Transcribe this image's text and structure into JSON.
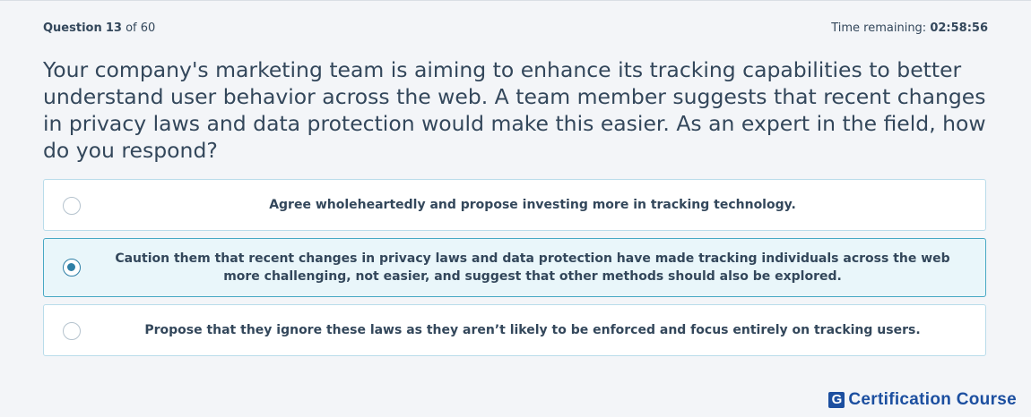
{
  "header": {
    "question_label": "Question",
    "question_number": "13",
    "question_of": "of 60",
    "time_label": "Time remaining:",
    "time_value": "02:58:56"
  },
  "question": {
    "text": "Your company's marketing team is aiming to enhance its tracking capabilities to better understand user behavior across the web. A team member suggests that recent changes in privacy laws and data protection would make this easier. As an expert in the field, how do you respond?"
  },
  "options": [
    {
      "text": "Agree wholeheartedly and propose investing more in tracking technology.",
      "selected": false
    },
    {
      "text": "Caution them that recent changes in privacy laws and data protection have made tracking individuals across the web more challenging, not easier, and suggest that other methods should also be explored.",
      "selected": true
    },
    {
      "text": "Propose that they ignore these laws as they aren’t likely to be enforced and focus entirely on tracking users.",
      "selected": false
    }
  ],
  "brand": {
    "logo_letter": "G",
    "name": "Certification Course",
    "color": "#1c4fa0"
  },
  "colors": {
    "text": "#33475b",
    "option_border": "#b9dcea",
    "selected_bg": "#e9f6fa",
    "selected_border": "#47a8c4",
    "radio_accent": "#2e7fa6"
  }
}
